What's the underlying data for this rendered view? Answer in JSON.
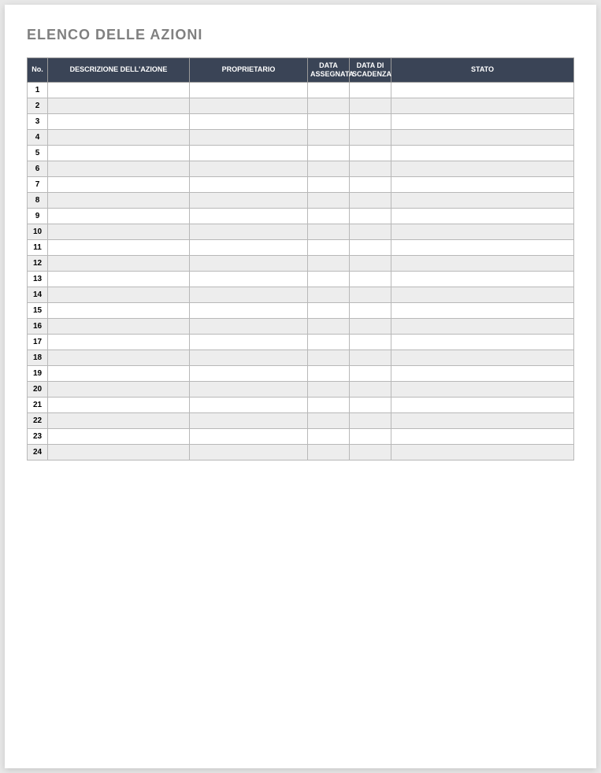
{
  "title": "ELENCO DELLE AZIONI",
  "columns": {
    "no": "No.",
    "description": "DESCRIZIONE DELL'AZIONE",
    "owner": "PROPRIETARIO",
    "assigned_date": "DATA ASSEGNATA",
    "due_date": "DATA DI SCADENZA",
    "status": "STATO"
  },
  "rows": [
    {
      "no": "1",
      "description": "",
      "owner": "",
      "assigned_date": "",
      "due_date": "",
      "status": ""
    },
    {
      "no": "2",
      "description": "",
      "owner": "",
      "assigned_date": "",
      "due_date": "",
      "status": ""
    },
    {
      "no": "3",
      "description": "",
      "owner": "",
      "assigned_date": "",
      "due_date": "",
      "status": ""
    },
    {
      "no": "4",
      "description": "",
      "owner": "",
      "assigned_date": "",
      "due_date": "",
      "status": ""
    },
    {
      "no": "5",
      "description": "",
      "owner": "",
      "assigned_date": "",
      "due_date": "",
      "status": ""
    },
    {
      "no": "6",
      "description": "",
      "owner": "",
      "assigned_date": "",
      "due_date": "",
      "status": ""
    },
    {
      "no": "7",
      "description": "",
      "owner": "",
      "assigned_date": "",
      "due_date": "",
      "status": ""
    },
    {
      "no": "8",
      "description": "",
      "owner": "",
      "assigned_date": "",
      "due_date": "",
      "status": ""
    },
    {
      "no": "9",
      "description": "",
      "owner": "",
      "assigned_date": "",
      "due_date": "",
      "status": ""
    },
    {
      "no": "10",
      "description": "",
      "owner": "",
      "assigned_date": "",
      "due_date": "",
      "status": ""
    },
    {
      "no": "11",
      "description": "",
      "owner": "",
      "assigned_date": "",
      "due_date": "",
      "status": ""
    },
    {
      "no": "12",
      "description": "",
      "owner": "",
      "assigned_date": "",
      "due_date": "",
      "status": ""
    },
    {
      "no": "13",
      "description": "",
      "owner": "",
      "assigned_date": "",
      "due_date": "",
      "status": ""
    },
    {
      "no": "14",
      "description": "",
      "owner": "",
      "assigned_date": "",
      "due_date": "",
      "status": ""
    },
    {
      "no": "15",
      "description": "",
      "owner": "",
      "assigned_date": "",
      "due_date": "",
      "status": ""
    },
    {
      "no": "16",
      "description": "",
      "owner": "",
      "assigned_date": "",
      "due_date": "",
      "status": ""
    },
    {
      "no": "17",
      "description": "",
      "owner": "",
      "assigned_date": "",
      "due_date": "",
      "status": ""
    },
    {
      "no": "18",
      "description": "",
      "owner": "",
      "assigned_date": "",
      "due_date": "",
      "status": ""
    },
    {
      "no": "19",
      "description": "",
      "owner": "",
      "assigned_date": "",
      "due_date": "",
      "status": ""
    },
    {
      "no": "20",
      "description": "",
      "owner": "",
      "assigned_date": "",
      "due_date": "",
      "status": ""
    },
    {
      "no": "21",
      "description": "",
      "owner": "",
      "assigned_date": "",
      "due_date": "",
      "status": ""
    },
    {
      "no": "22",
      "description": "",
      "owner": "",
      "assigned_date": "",
      "due_date": "",
      "status": ""
    },
    {
      "no": "23",
      "description": "",
      "owner": "",
      "assigned_date": "",
      "due_date": "",
      "status": ""
    },
    {
      "no": "24",
      "description": "",
      "owner": "",
      "assigned_date": "",
      "due_date": "",
      "status": ""
    }
  ]
}
